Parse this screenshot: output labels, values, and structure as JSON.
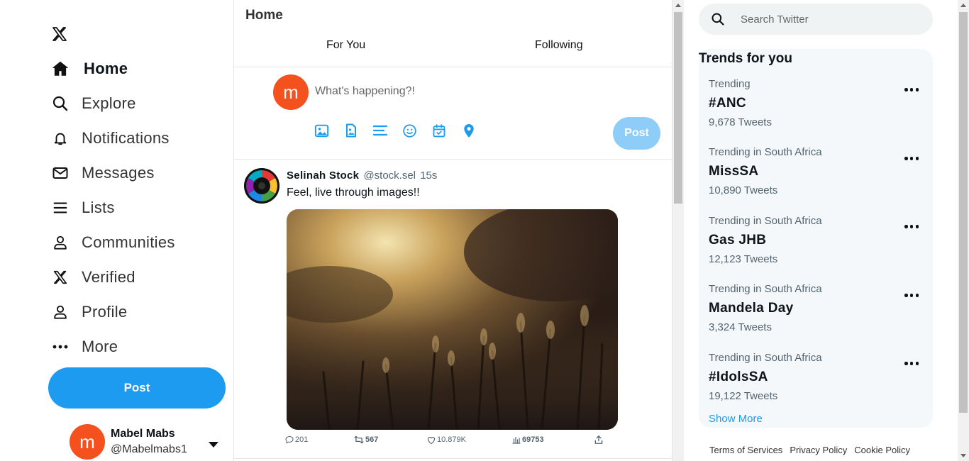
{
  "colors": {
    "accent": "#1d9bf0",
    "avatar": "#f4511e",
    "post_disabled": "#8ecdf8"
  },
  "sidebar": {
    "logo": "x-logo-icon",
    "items": [
      {
        "label": "Home",
        "icon": "home-icon",
        "active": true
      },
      {
        "label": "Explore",
        "icon": "search-icon"
      },
      {
        "label": "Notifications",
        "icon": "bell-icon"
      },
      {
        "label": "Messages",
        "icon": "mail-icon"
      },
      {
        "label": "Lists",
        "icon": "list-icon"
      },
      {
        "label": "Communities",
        "icon": "people-icon"
      },
      {
        "label": "Verified",
        "icon": "x-logo-icon"
      },
      {
        "label": "Profile",
        "icon": "person-icon"
      },
      {
        "label": "More",
        "icon": "more-icon"
      }
    ],
    "post_label": "Post",
    "account": {
      "avatar_letter": "m",
      "display_name": "Mabel Mabs",
      "handle": "@Mabelmabs1"
    }
  },
  "main": {
    "title": "Home",
    "tabs": [
      {
        "label": "For You"
      },
      {
        "label": "Following"
      }
    ],
    "compose": {
      "avatar_letter": "m",
      "placeholder": "What's happening?!",
      "icons": [
        "image-icon",
        "gif-icon",
        "poll-icon",
        "emoji-icon",
        "schedule-icon",
        "location-icon"
      ],
      "post_label": "Post"
    },
    "tweet": {
      "display_name": "Selinah Stock",
      "handle": "@stock.sel",
      "time": "15s",
      "text": "Feel, live through images!!",
      "replies": "201",
      "retweets": "567",
      "likes": "10.879K",
      "views": "69753"
    }
  },
  "right": {
    "search_placeholder": "Search Twitter",
    "trends_title": "Trends for you",
    "trends": [
      {
        "category": "Trending",
        "name": "#ANC",
        "count": "9,678 Tweets"
      },
      {
        "category": "Trending in South Africa",
        "name": "MissSA",
        "count": "10,890 Tweets"
      },
      {
        "category": "Trending in South Africa",
        "name": "Gas JHB",
        "count": "12,123 Tweets"
      },
      {
        "category": "Trending in South Africa",
        "name": "Mandela Day",
        "count": "3,324 Tweets"
      },
      {
        "category": "Trending in South Africa",
        "name": "#IdolsSA",
        "count": "19,122 Tweets"
      }
    ],
    "show_more": "Show More",
    "footer": [
      "Terms of Services",
      "Privacy Policy",
      "Cookie Policy"
    ]
  }
}
